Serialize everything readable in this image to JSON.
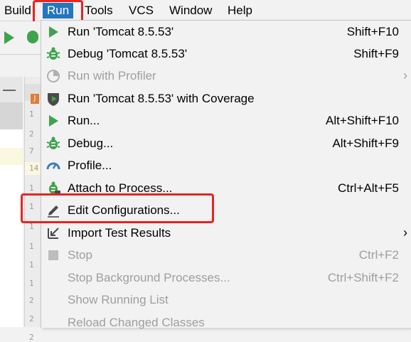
{
  "menubar": {
    "items": [
      {
        "label": "Build",
        "name": "menu-build"
      },
      {
        "label": "Run",
        "name": "menu-run"
      },
      {
        "label": "Tools",
        "name": "menu-tools"
      },
      {
        "label": "VCS",
        "name": "menu-vcs"
      },
      {
        "label": "Window",
        "name": "menu-window"
      },
      {
        "label": "Help",
        "name": "menu-help"
      }
    ]
  },
  "gutter": {
    "tab_badge": "J",
    "line_numbers": [
      "1",
      "2",
      "7",
      "14",
      "1",
      "1",
      "1",
      "1",
      "1",
      "1",
      "2",
      "2",
      "2"
    ]
  },
  "run_menu": {
    "items": [
      {
        "label": "Run 'Tomcat 8.5.53'",
        "shortcut": "Shift+F10",
        "icon": "run-icon",
        "enabled": true,
        "submenu": false
      },
      {
        "label": "Debug 'Tomcat 8.5.53'",
        "shortcut": "Shift+F9",
        "icon": "debug-icon",
        "enabled": true,
        "submenu": false
      },
      {
        "label": "Run with Profiler",
        "shortcut": "",
        "icon": "profiler-icon",
        "enabled": false,
        "submenu": true
      },
      {
        "label": "Run 'Tomcat 8.5.53' with Coverage",
        "shortcut": "",
        "icon": "coverage-icon",
        "enabled": true,
        "submenu": false
      },
      {
        "label": "Run...",
        "shortcut": "Alt+Shift+F10",
        "icon": "run-icon",
        "enabled": true,
        "submenu": false
      },
      {
        "label": "Debug...",
        "shortcut": "Alt+Shift+F9",
        "icon": "debug-icon",
        "enabled": true,
        "submenu": false
      },
      {
        "label": "Profile...",
        "shortcut": "",
        "icon": "profile-icon",
        "enabled": true,
        "submenu": false
      },
      {
        "label": "Attach to Process...",
        "shortcut": "Ctrl+Alt+F5",
        "icon": "attach-icon",
        "enabled": true,
        "submenu": false
      },
      {
        "label": "Edit Configurations...",
        "shortcut": "",
        "icon": "edit-icon",
        "enabled": true,
        "submenu": false
      },
      {
        "label": "Import Test Results",
        "shortcut": "",
        "icon": "import-icon",
        "enabled": true,
        "submenu": true
      },
      {
        "label": "Stop",
        "shortcut": "Ctrl+F2",
        "icon": "stop-icon",
        "enabled": false,
        "submenu": false
      },
      {
        "label": "Stop Background Processes...",
        "shortcut": "Ctrl+Shift+F2",
        "icon": "",
        "enabled": false,
        "submenu": false
      },
      {
        "label": "Show Running List",
        "shortcut": "",
        "icon": "",
        "enabled": false,
        "submenu": false
      },
      {
        "label": "Reload Changed Classes",
        "shortcut": "",
        "icon": "",
        "enabled": false,
        "submenu": false
      }
    ],
    "submenu_arrow": "›"
  },
  "colors": {
    "menu_active_bg": "#2675bf",
    "highlight_box": "#e82323",
    "run_green": "#3fa34d",
    "disabled_text": "#9e9e9e"
  }
}
